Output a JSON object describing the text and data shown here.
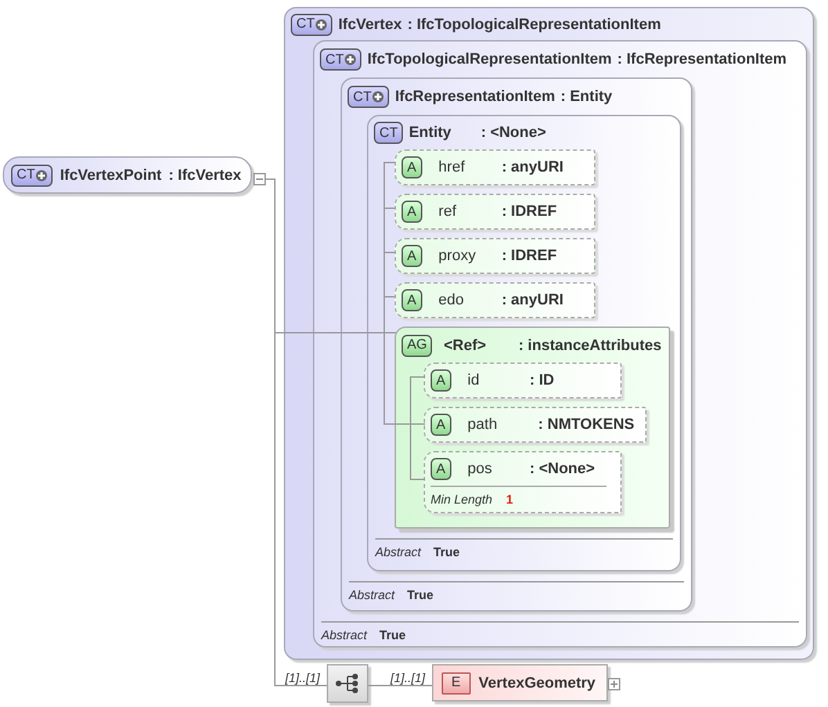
{
  "root_type": {
    "badge": "CT",
    "name": "IfcVertexPoint",
    "base": ": IfcVertex",
    "derived": true,
    "expanded": true
  },
  "content_model": {
    "badge": "CT",
    "name": "IfcVertex",
    "base": ": IfcTopologicalRepresentationItem",
    "derived": true,
    "child": {
      "badge": "CT",
      "name": "IfcTopologicalRepresentationItem",
      "base": ": IfcRepresentationItem",
      "derived": true,
      "abstract": {
        "label": "Abstract",
        "value": "True"
      },
      "child": {
        "badge": "CT",
        "name": "IfcRepresentationItem",
        "base": ": Entity",
        "derived": true,
        "abstract": {
          "label": "Abstract",
          "value": "True"
        },
        "child": {
          "badge": "CT",
          "name": "Entity",
          "base": ": <None>",
          "derived": false,
          "abstract": {
            "label": "Abstract",
            "value": "True"
          },
          "attributes": [
            {
              "badge": "A",
              "name": "href",
              "type": ": anyURI"
            },
            {
              "badge": "A",
              "name": "ref",
              "type": ": IDREF"
            },
            {
              "badge": "A",
              "name": "proxy",
              "type": ": IDREF"
            },
            {
              "badge": "A",
              "name": "edo",
              "type": ": anyURI"
            }
          ],
          "attribute_group": {
            "badge": "AG",
            "name": "<Ref>",
            "type": ": instanceAttributes",
            "attributes": [
              {
                "badge": "A",
                "name": "id",
                "type": ": ID"
              },
              {
                "badge": "A",
                "name": "path",
                "type": ": NMTOKENS"
              },
              {
                "badge": "A",
                "name": "pos",
                "type": ": <None>",
                "facets": [
                  {
                    "label": "Min Length",
                    "value": "1"
                  }
                ]
              }
            ]
          }
        }
      }
    }
  },
  "sequence": {
    "occurrence": "[1]..[1]"
  },
  "element": {
    "occurrence": "[1]..[1]",
    "badge": "E",
    "name": "VertexGeometry",
    "expanded": false
  }
}
